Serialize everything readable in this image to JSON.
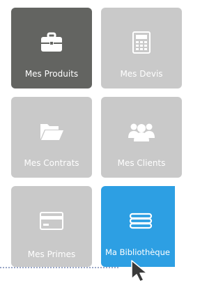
{
  "tiles": [
    {
      "label": "Mes Produits",
      "icon": "briefcase-icon",
      "state": "active"
    },
    {
      "label": "Mes Devis",
      "icon": "calculator-icon",
      "state": "default"
    },
    {
      "label": "Mes Contrats",
      "icon": "folder-icon",
      "state": "default"
    },
    {
      "label": "Mes Clients",
      "icon": "users-icon",
      "state": "default"
    },
    {
      "label": "Mes Primes",
      "icon": "credit-card-icon",
      "state": "default"
    },
    {
      "label": "Ma Bibliothèque",
      "icon": "books-icon",
      "state": "hover"
    }
  ],
  "colors": {
    "tile_default": "#c9c9c9",
    "tile_active": "#636461",
    "tile_hover": "#2d9fe3",
    "label": "#ffffff"
  }
}
